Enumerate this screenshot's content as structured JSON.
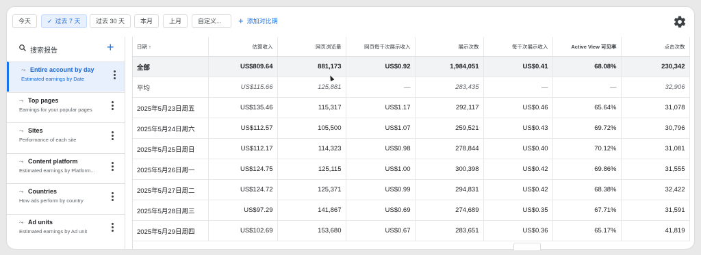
{
  "toolbar": {
    "chips": [
      "今天",
      "过去 7 天",
      "过去 30 天",
      "本月",
      "上月",
      "自定义..."
    ],
    "active_check": "✓",
    "compare": "添加对比期",
    "compare_plus": "+",
    "settings_icon": "gear-icon"
  },
  "sidebar": {
    "search_placeholder": "搜索报告",
    "add": "+",
    "reports": [
      {
        "title": "Entire account by day",
        "subtitle": "Estimated earnings by Date",
        "icon": "trend-icon"
      },
      {
        "title": "Top pages",
        "subtitle": "Earnings for your popular pages",
        "icon": "trend-icon"
      },
      {
        "title": "Sites",
        "subtitle": "Performance of each site",
        "icon": "trend-icon"
      },
      {
        "title": "Content platform",
        "subtitle": "Estimated earnings by Platform...",
        "icon": "trend-icon"
      },
      {
        "title": "Countries",
        "subtitle": "How ads perform by country",
        "icon": "trend-icon"
      },
      {
        "title": "Ad units",
        "subtitle": "Estimated earnings by Ad unit",
        "icon": "trend-icon"
      }
    ]
  },
  "table": {
    "headers": [
      "日期 ↑",
      "估算收入",
      "网页浏览量",
      "网页每千次展示收入",
      "展示次数",
      "每千次展示收入",
      "Active View 可见率",
      "点击次数"
    ],
    "total": [
      "全部",
      "US$809.64",
      "881,173",
      "US$0.92",
      "1,984,051",
      "US$0.41",
      "68.08%",
      "230,342"
    ],
    "average": [
      "平均",
      "US$115.66",
      "125,881",
      "—",
      "283,435",
      "—",
      "—",
      "32,906"
    ],
    "rows": [
      [
        "2025年5月23日周五",
        "US$135.46",
        "115,317",
        "US$1.17",
        "292,117",
        "US$0.46",
        "65.64%",
        "31,078"
      ],
      [
        "2025年5月24日周六",
        "US$112.57",
        "105,500",
        "US$1.07",
        "259,521",
        "US$0.43",
        "69.72%",
        "30,796"
      ],
      [
        "2025年5月25日周日",
        "US$112.17",
        "114,323",
        "US$0.98",
        "278,844",
        "US$0.40",
        "70.12%",
        "31,081"
      ],
      [
        "2025年5月26日周一",
        "US$124.75",
        "125,115",
        "US$1.00",
        "300,398",
        "US$0.42",
        "69.86%",
        "31,555"
      ],
      [
        "2025年5月27日周二",
        "US$124.72",
        "125,371",
        "US$0.99",
        "294,831",
        "US$0.42",
        "68.38%",
        "32,422"
      ],
      [
        "2025年5月28日周三",
        "US$97.29",
        "141,867",
        "US$0.69",
        "274,689",
        "US$0.35",
        "67.71%",
        "31,591"
      ],
      [
        "2025年5月29日周四",
        "US$102.69",
        "153,680",
        "US$0.67",
        "283,651",
        "US$0.36",
        "65.17%",
        "41,819"
      ]
    ]
  }
}
